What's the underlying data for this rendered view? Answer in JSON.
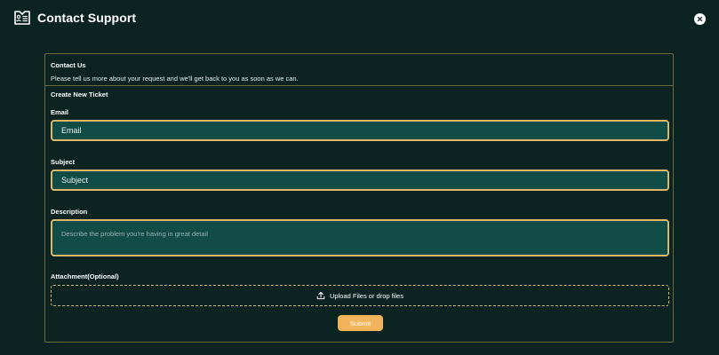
{
  "header": {
    "title": "Contact Support",
    "icon": "support-ticket-icon"
  },
  "close": {
    "icon": "close-icon"
  },
  "panel": {
    "title": "Contact Us",
    "description": "Please tell us more about your request and we'll get back to you as soon as we can.",
    "section_title": "Create New Ticket"
  },
  "form": {
    "email": {
      "label": "Email",
      "placeholder": "Email"
    },
    "subject": {
      "label": "Subject",
      "placeholder": "Subject"
    },
    "description": {
      "label": "Description",
      "placeholder": "Describe the problem you're having in great detail"
    },
    "attachment": {
      "label": "Attachment(Optional)",
      "upload_text": "Upload Files or drop files",
      "icon": "upload-icon"
    },
    "submit_label": "Submit"
  },
  "colors": {
    "background": "#0b2321",
    "input_fill": "#114c47",
    "accent_border": "#d9b86a",
    "submit": "#f2b45a",
    "panel_border": "#6c6a3d"
  }
}
